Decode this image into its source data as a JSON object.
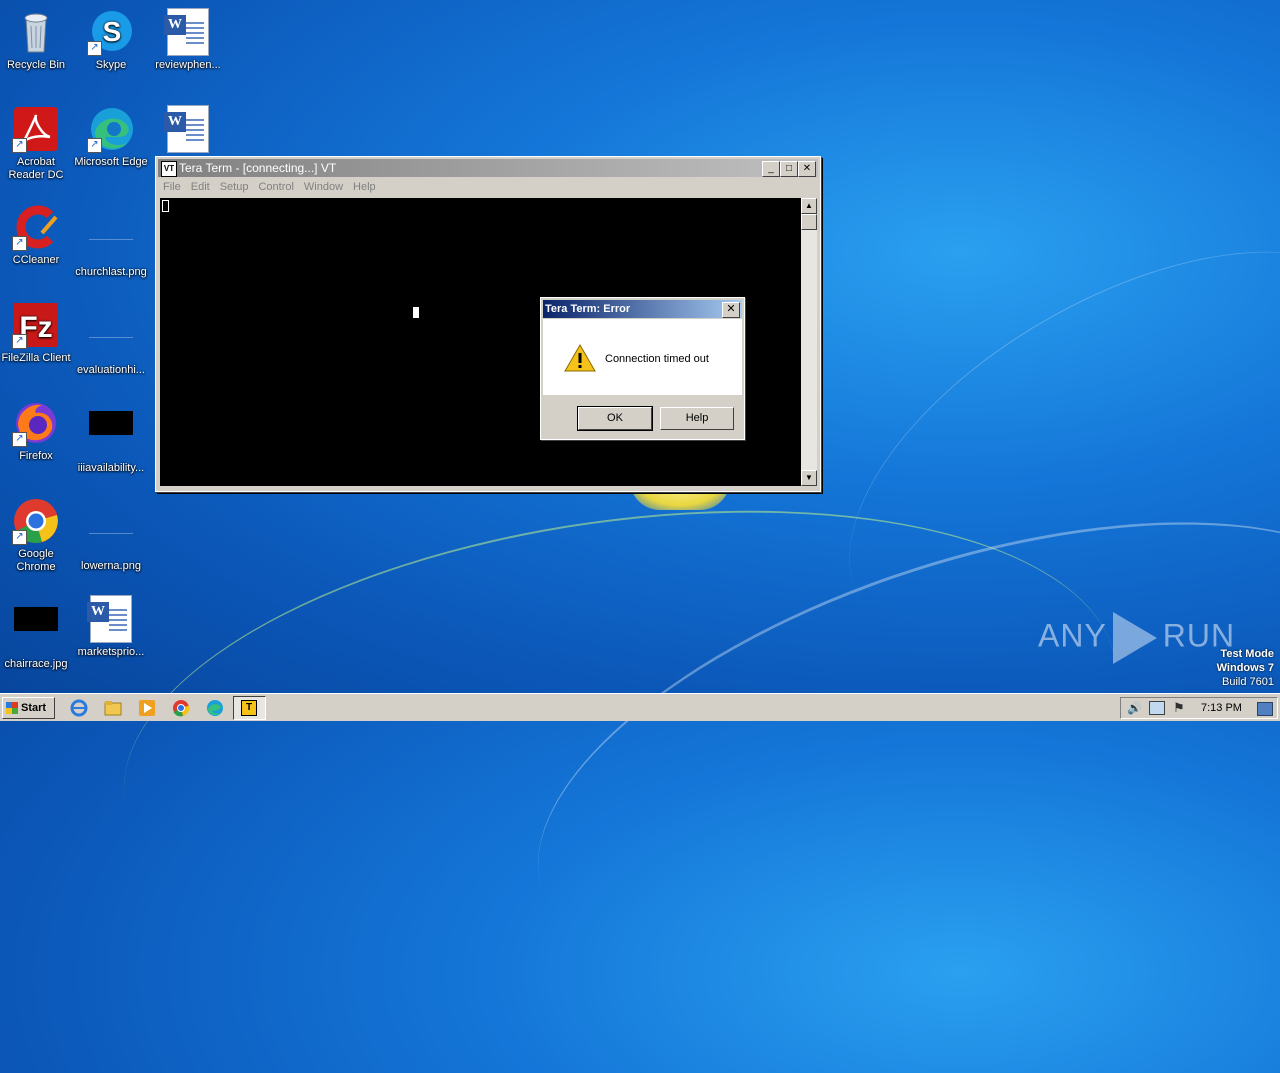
{
  "desktop": {
    "icons": [
      {
        "label": "Recycle Bin",
        "icon": "recycle-bin-icon"
      },
      {
        "label": "Skype",
        "icon": "skype-icon"
      },
      {
        "label": "reviewphen...",
        "icon": "word-doc-icon"
      },
      {
        "label": "Acrobat Reader DC",
        "icon": "acrobat-icon"
      },
      {
        "label": "Microsoft Edge",
        "icon": "edge-icon"
      },
      {
        "label": "",
        "icon": "word-doc-icon"
      },
      {
        "label": "CCleaner",
        "icon": "ccleaner-icon"
      },
      {
        "label": "churchlast.png",
        "icon": "image-file-icon"
      },
      {
        "label": "FileZilla Client",
        "icon": "filezilla-icon"
      },
      {
        "label": "evaluationhi...",
        "icon": "file-icon"
      },
      {
        "label": "Firefox",
        "icon": "firefox-icon"
      },
      {
        "label": "iiiavailability...",
        "icon": "image-file-icon"
      },
      {
        "label": "Google Chrome",
        "icon": "chrome-icon"
      },
      {
        "label": "lowerna.png",
        "icon": "image-file-icon"
      },
      {
        "label": "chairrace.jpg",
        "icon": "image-file-icon"
      },
      {
        "label": "marketsprio...",
        "icon": "word-doc-icon"
      }
    ]
  },
  "teraterm": {
    "title": "Tera Term - [connecting...] VT",
    "icon_text": "VT",
    "controls": {
      "minimize": "_",
      "maximize": "□",
      "close": "✕"
    },
    "menu": [
      "File",
      "Edit",
      "Setup",
      "Control",
      "Window",
      "Help"
    ]
  },
  "error_dialog": {
    "title": "Tera Term: Error",
    "message": "Connection timed out",
    "close": "✕",
    "ok_label": "OK",
    "help_label": "Help"
  },
  "watermark": {
    "brand_left": "ANY",
    "brand_right": "RUN",
    "line1": "Test Mode",
    "line2": "Windows 7",
    "line3": "Build 7601"
  },
  "taskbar": {
    "start_label": "Start",
    "clock": "7:13 PM",
    "icon_text": "T"
  }
}
